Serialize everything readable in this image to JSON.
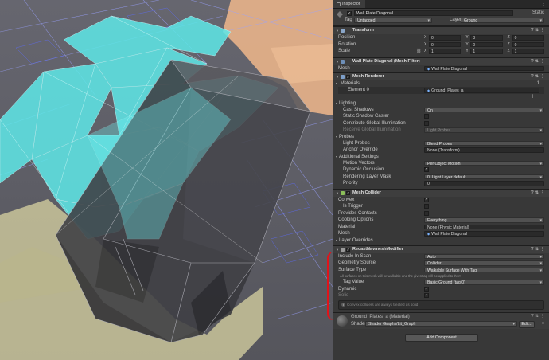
{
  "inspector": {
    "tab_label": "Inspector",
    "object": {
      "name": "Wall Plate Diagonal",
      "static_label": "Static",
      "tag_label": "Tag",
      "tag_value": "Untagged",
      "layer_label": "Layer",
      "layer_value": "Ground"
    },
    "transform": {
      "title": "Transform",
      "rows": [
        {
          "label": "Position",
          "x": "0",
          "y": "3",
          "z": "0"
        },
        {
          "label": "Rotation",
          "x": "0",
          "y": "0",
          "z": "0"
        },
        {
          "label": "Scale",
          "x": "1",
          "y": "1",
          "z": "1"
        }
      ]
    },
    "mesh_filter": {
      "title": "Wall Plate Diagonal (Mesh Filter)",
      "mesh_label": "Mesh",
      "mesh_value": "Wall Plate Diagonal"
    },
    "mesh_renderer": {
      "title": "Mesh Renderer",
      "materials_label": "Materials",
      "materials_count": "1",
      "element_label": "Element 0",
      "element_value": "Ground_Plates_a",
      "lighting_label": "Lighting",
      "cast_shadows_label": "Cast Shadows",
      "cast_shadows_value": "On",
      "static_shadow_label": "Static Shadow Caster",
      "contribute_gi_label": "Contribute Global Illumination",
      "receive_gi_label": "Receive Global Illumination",
      "receive_gi_value": "Light Probes",
      "probes_label": "Probes",
      "light_probes_label": "Light Probes",
      "light_probes_value": "Blend Probes",
      "anchor_label": "Anchor Override",
      "anchor_value": "None (Transform)",
      "additional_label": "Additional Settings",
      "motion_label": "Motion Vectors",
      "motion_value": "Per Object Motion",
      "dyn_occ_label": "Dynamic Occlusion",
      "layer_mask_label": "Rendering Layer Mask",
      "layer_mask_value": "0: Light Layer default",
      "priority_label": "Priority",
      "priority_value": "0"
    },
    "mesh_collider": {
      "title": "Mesh Collider",
      "convex_label": "Convex",
      "trigger_label": "Is Trigger",
      "contacts_label": "Provides Contacts",
      "cooking_label": "Cooking Options",
      "cooking_value": "Everything",
      "material_label": "Material",
      "material_value": "None (Physic Material)",
      "mesh_label": "Mesh",
      "mesh_value": "Wall Plate Diagonal",
      "layer_overrides_label": "Layer Overrides"
    },
    "recast": {
      "title": "RecastNavmeshModifier",
      "include_label": "Include In Scan",
      "include_value": "Auto",
      "geometry_label": "Geometry Source",
      "geometry_value": "Collider",
      "surface_label": "Surface Type",
      "surface_value": "Walkable Surface With Tag",
      "note": "All surfaces on this mesh will be walkable and the given tag will be applied to them",
      "tag_value_label": "Tag Value",
      "tag_value_value": "Basic Ground (tag 0)",
      "dynamic_label": "Dynamic",
      "solid_label": "Solid",
      "help": "Convex colliders are always treated as solid"
    },
    "material": {
      "name": "Ground_Plates_a (Material)",
      "shader_label": "Shader",
      "shader_value": "Shader Graphs/Lit_Graph",
      "edit_label": "Edit..."
    },
    "add_component_label": "Add Component"
  }
}
